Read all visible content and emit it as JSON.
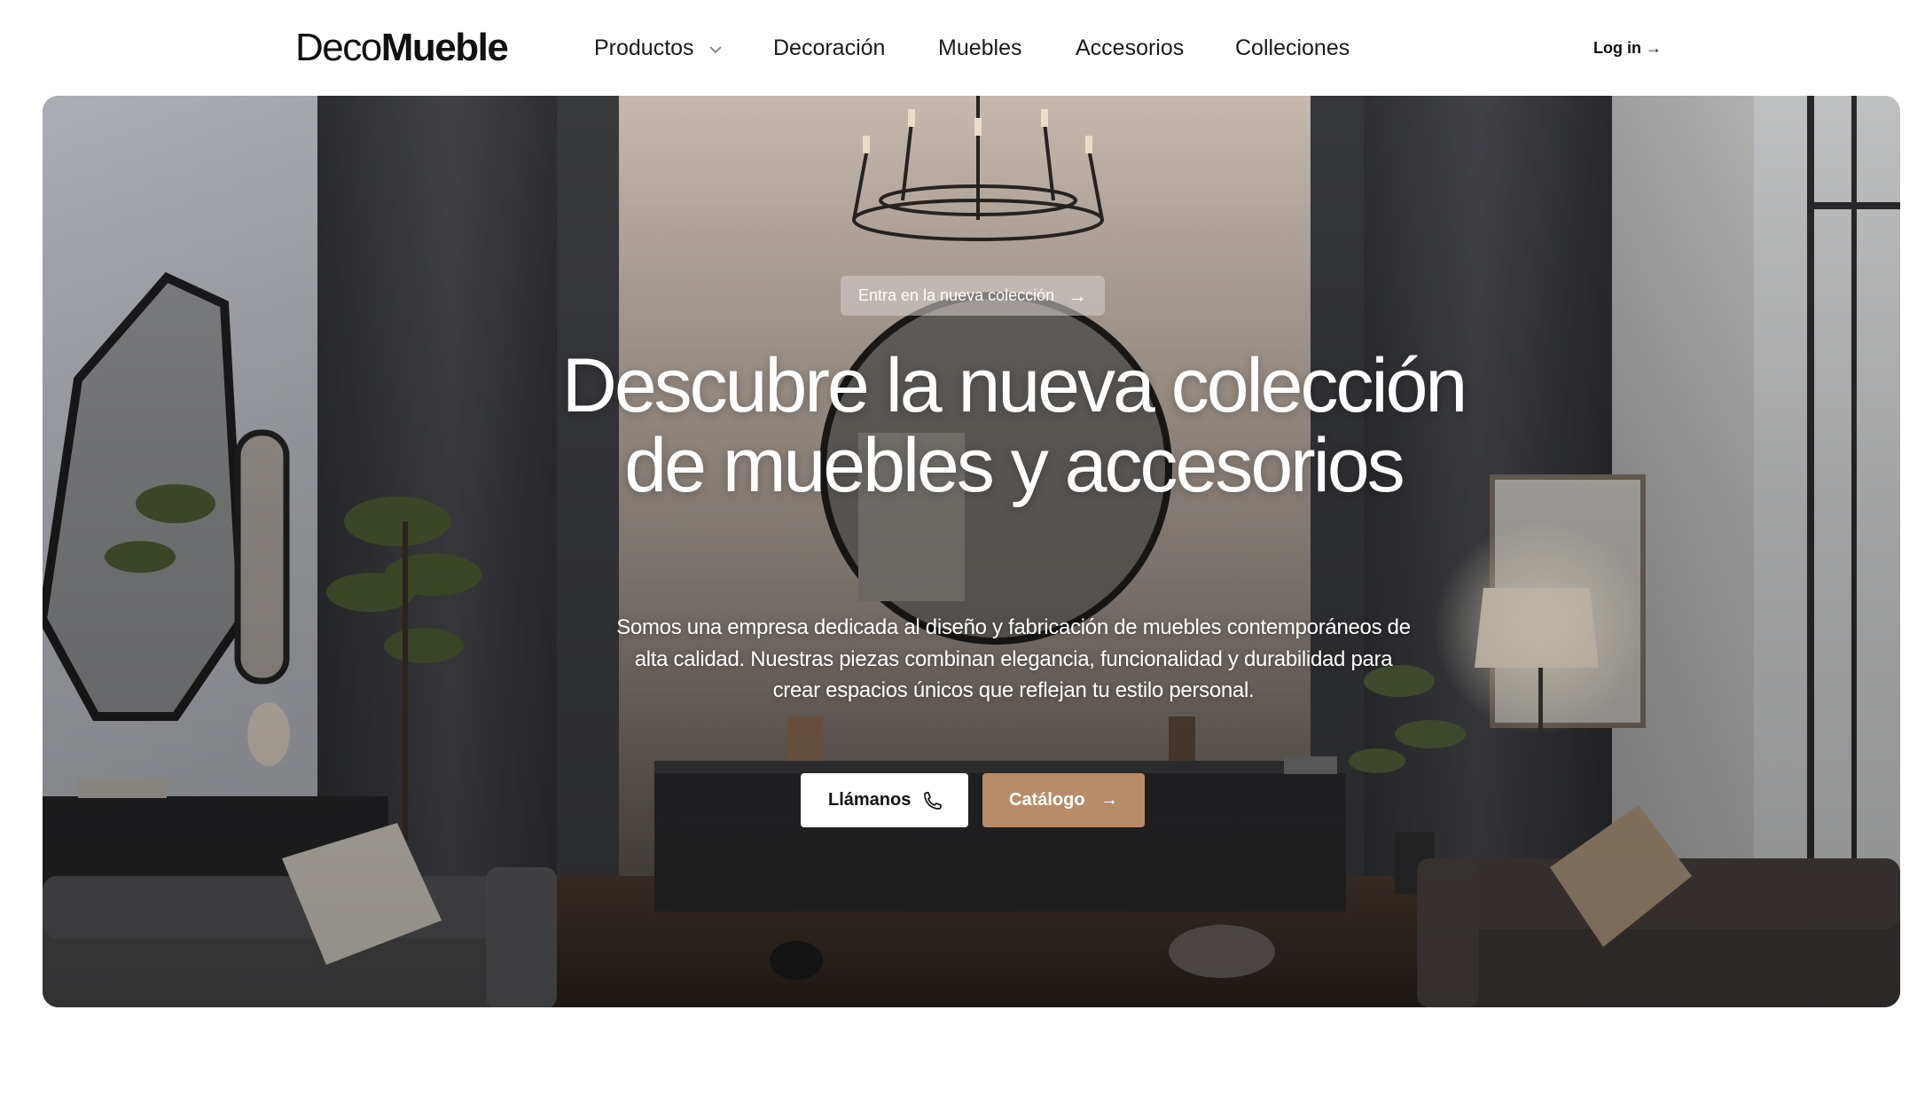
{
  "brand": {
    "light": "Deco",
    "bold": "Mueble"
  },
  "nav": {
    "items": [
      {
        "label": "Productos",
        "has_dropdown": true
      },
      {
        "label": "Decoración"
      },
      {
        "label": "Muebles"
      },
      {
        "label": "Accesorios"
      },
      {
        "label": "Colleciones"
      }
    ],
    "login": "Log in →"
  },
  "hero": {
    "announcement": "Entra en la nueva colección",
    "announcement_icon": "arrow-right-icon",
    "headline": "Descubre la nueva colección de muebles y accesorios",
    "description": "Somos una empresa dedicada al diseño y fabricación de muebles contemporáneos de alta calidad. Nuestras piezas combinan elegancia, funcionalidad y durabilidad para crear espacios únicos que reflejan tu estilo personal.",
    "primary_button": {
      "label": "Llámanos",
      "icon": "phone-icon"
    },
    "secondary_button": {
      "label": "Catálogo",
      "icon": "arrow-right-icon"
    }
  },
  "colors": {
    "accent": "#b88c68",
    "background": "#ffffff",
    "text": "#111111"
  }
}
